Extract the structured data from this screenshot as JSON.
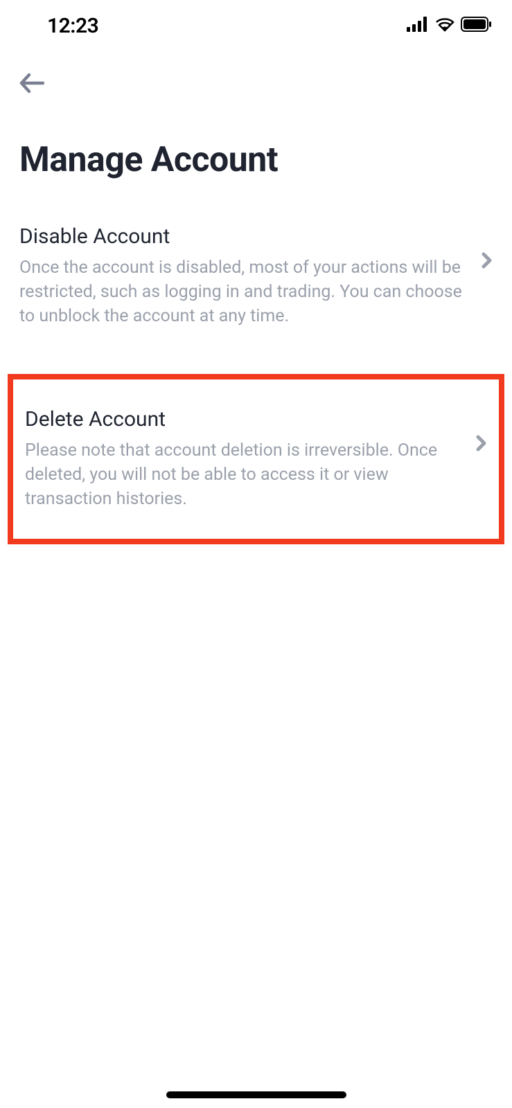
{
  "status": {
    "time": "12:23"
  },
  "page": {
    "title": "Manage Account"
  },
  "options": [
    {
      "title": "Disable Account",
      "desc": "Once the account is disabled, most of your actions will be restricted, such as logging in and trading. You can choose to unblock the account at any time."
    },
    {
      "title": "Delete Account",
      "desc": "Please note that account deletion is irreversible. Once deleted, you will not be able to access it or view transaction histories."
    }
  ]
}
